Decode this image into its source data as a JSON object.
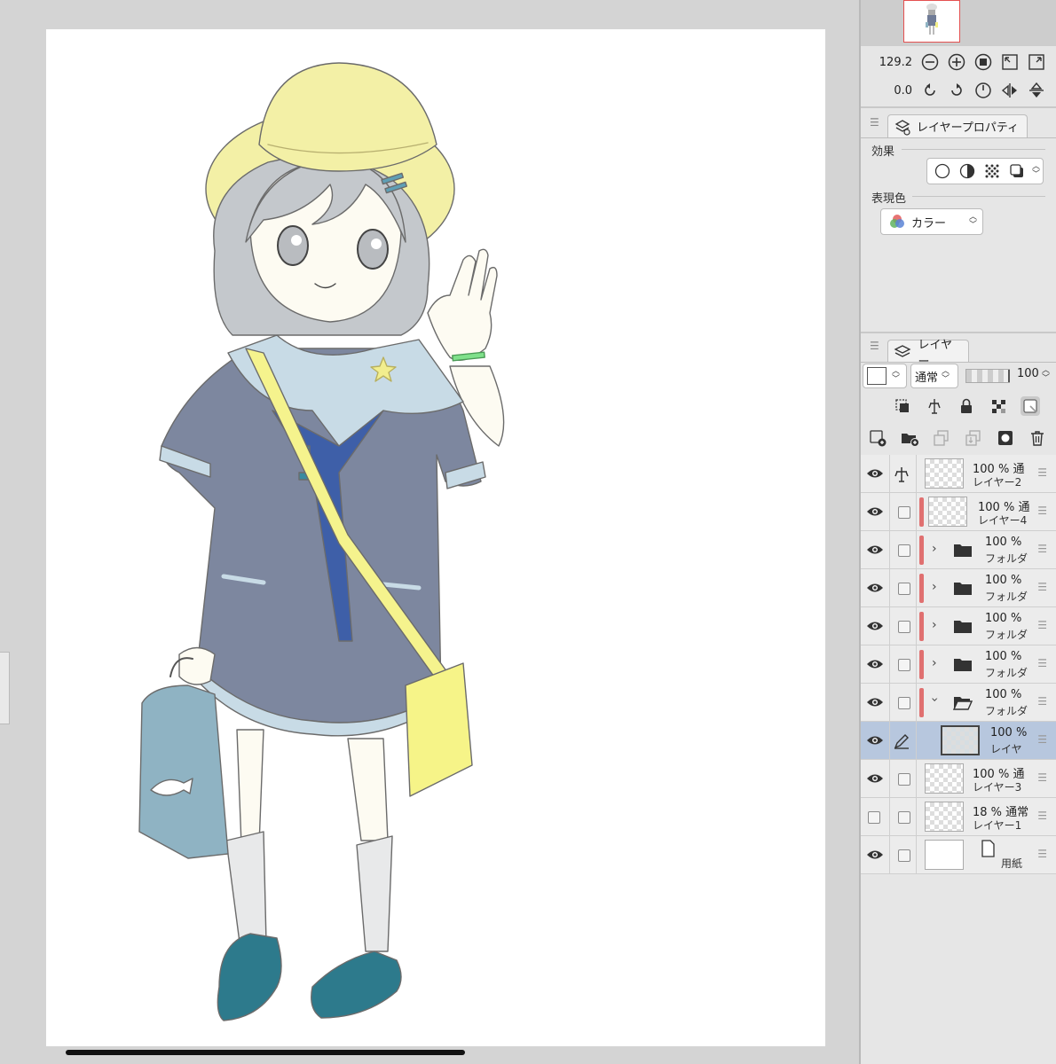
{
  "navigator": {
    "zoom_value": "129.2",
    "rotation_value": "0.0"
  },
  "properties_panel": {
    "tab_label": "レイヤープロパティ",
    "effect_label": "効果",
    "expression_color_label": "表現色",
    "expression_color_value": "カラー"
  },
  "layers_panel": {
    "tab_label": "レイヤー",
    "blend_mode": "通常",
    "opacity": "100",
    "layers": [
      {
        "percent": "100 %",
        "mode": "通",
        "name": "レイヤー2",
        "kind": "layer",
        "visible": true,
        "mark": "reference"
      },
      {
        "percent": "100 %",
        "mode": "通",
        "name": "レイヤー4",
        "kind": "layer",
        "visible": true,
        "mark": "none"
      },
      {
        "percent": "100 %",
        "mode": "",
        "name": "フォルダ",
        "kind": "folder",
        "visible": true,
        "mark": "none"
      },
      {
        "percent": "100 %",
        "mode": "",
        "name": "フォルダ",
        "kind": "folder",
        "visible": true,
        "mark": "none"
      },
      {
        "percent": "100 %",
        "mode": "",
        "name": "フォルダ",
        "kind": "folder",
        "visible": true,
        "mark": "none"
      },
      {
        "percent": "100 %",
        "mode": "",
        "name": "フォルダ",
        "kind": "folder",
        "visible": true,
        "mark": "none"
      },
      {
        "percent": "100 %",
        "mode": "",
        "name": "フォルダ",
        "kind": "folder-open",
        "visible": true,
        "mark": "none"
      },
      {
        "percent": "100 %",
        "mode": "",
        "name": "レイヤ",
        "kind": "layer",
        "visible": true,
        "mark": "pen",
        "selected": true
      },
      {
        "percent": "100 %",
        "mode": "通",
        "name": "レイヤー3",
        "kind": "layer",
        "visible": true,
        "mark": "none"
      },
      {
        "percent": "18 %",
        "mode": "通常",
        "name": "レイヤー1",
        "kind": "layer",
        "visible": false,
        "mark": "none"
      },
      {
        "percent": "",
        "mode": "",
        "name": "用紙",
        "kind": "paper",
        "visible": true,
        "mark": "none"
      }
    ]
  },
  "colors": {
    "hat": "#f3f0a6",
    "hair": "#c4c8cc",
    "dress": "#7d879f",
    "collar": "#c8dbe6",
    "tie": "#3e5fa8",
    "strap": "#f5f38d",
    "bag_yellow": "#f6f488",
    "bag_blue": "#8fb3c3",
    "shoes": "#2d7a8c",
    "socks": "#e8e9ea",
    "skin": "#fdfbf2"
  }
}
